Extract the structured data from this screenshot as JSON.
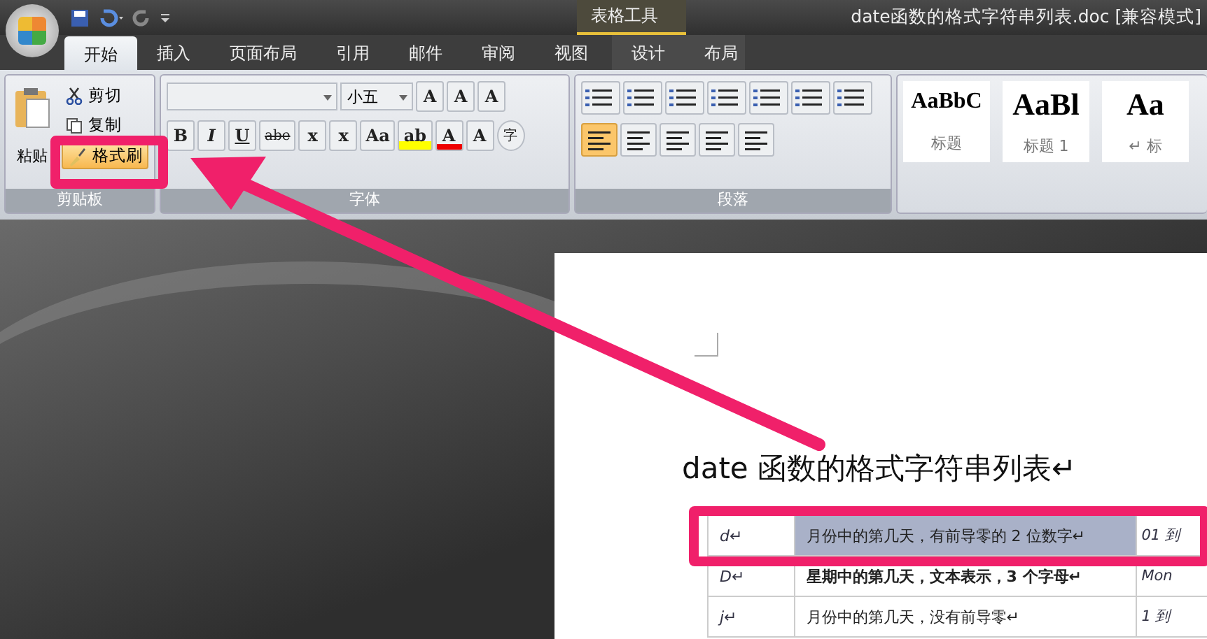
{
  "window": {
    "title": "date函数的格式字符串列表.doc [兼容模式]",
    "context_group": "表格工具"
  },
  "tabs": [
    {
      "label": "开始",
      "selected": true
    },
    {
      "label": "插入",
      "selected": false
    },
    {
      "label": "页面布局",
      "selected": false
    },
    {
      "label": "引用",
      "selected": false
    },
    {
      "label": "邮件",
      "selected": false
    },
    {
      "label": "审阅",
      "selected": false
    },
    {
      "label": "视图",
      "selected": false
    }
  ],
  "context_tabs": [
    {
      "label": "设计",
      "selected": false
    },
    {
      "label": "布局",
      "selected": false
    }
  ],
  "clipboard": {
    "paste": "粘贴",
    "cut": "剪切",
    "copy": "复制",
    "format_painter": "格式刷",
    "group": "剪贴板"
  },
  "font": {
    "size": "小五",
    "row1": [
      "A",
      "A",
      "A"
    ],
    "row2": [
      "B",
      "I",
      "U",
      "abe",
      "x",
      "x",
      "Aa",
      "ab",
      "A",
      "A",
      "字"
    ],
    "group": "字体"
  },
  "paragraph": {
    "group": "段落",
    "align_buttons": [
      {
        "selected": true
      },
      {
        "selected": false
      },
      {
        "selected": false
      },
      {
        "selected": false
      },
      {
        "selected": false
      }
    ]
  },
  "styles": [
    {
      "preview": "AaBbC",
      "label": "标题"
    },
    {
      "preview": "AaBl",
      "label": "标题 1"
    },
    {
      "preview": "Aa",
      "label": "↵ 标"
    }
  ],
  "document": {
    "heading": "date 函数的格式字符串列表↵",
    "rows": [
      {
        "cells": [
          "d↵",
          "月份中的第几天，有前导零的 2 位数字↵",
          "01 到"
        ],
        "selected": true,
        "bold": false
      },
      {
        "cells": [
          "D↵",
          "星期中的第几天，文本表示，3 个字母↵",
          "Mon"
        ],
        "selected": false,
        "bold": true
      },
      {
        "cells": [
          "j↵",
          "月份中的第几天，没有前导零↵",
          "1 到"
        ],
        "selected": false,
        "bold": false
      }
    ]
  }
}
